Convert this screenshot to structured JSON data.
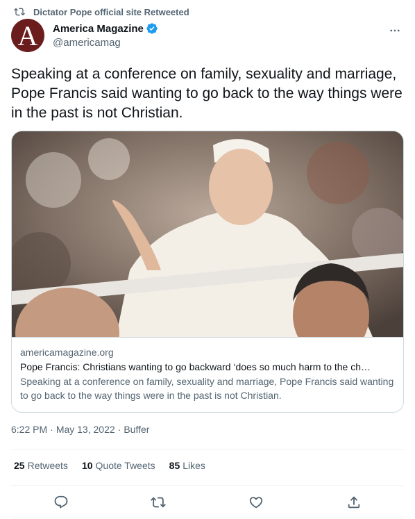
{
  "retweet_context": {
    "text": "Dictator Pope official site Retweeted",
    "icon": "retweet-icon"
  },
  "author": {
    "display_name": "America Magazine",
    "handle": "@americamag",
    "verified": true,
    "avatar_letter": "A",
    "avatar_color": "#6b1d1d"
  },
  "tweet": {
    "text": "Speaking at a conference on family, sexuality and marriage, Pope Francis said wanting to go back to the way things were in the past is not Christian."
  },
  "card": {
    "domain": "americamagazine.org",
    "title": "Pope Francis: Christians wanting to go backward ‘does so much harm to the ch…",
    "description": "Speaking at a conference on family, sexuality and marriage, Pope Francis said wanting to go back to the way things were in the past is not Christian."
  },
  "meta": {
    "time": "6:22 PM",
    "separator1": "·",
    "date": "May 13, 2022",
    "separator2": "·",
    "source": "Buffer"
  },
  "stats": {
    "retweets_count": "25",
    "retweets_label": "Retweets",
    "quotes_count": "10",
    "quotes_label": "Quote Tweets",
    "likes_count": "85",
    "likes_label": "Likes"
  },
  "actions": {
    "reply": "reply-icon",
    "retweet": "retweet-icon",
    "like": "heart-icon",
    "share": "share-icon"
  },
  "colors": {
    "text_primary": "#0f1419",
    "text_secondary": "#536471",
    "verified": "#1d9bf0",
    "border": "#cfd9de"
  }
}
